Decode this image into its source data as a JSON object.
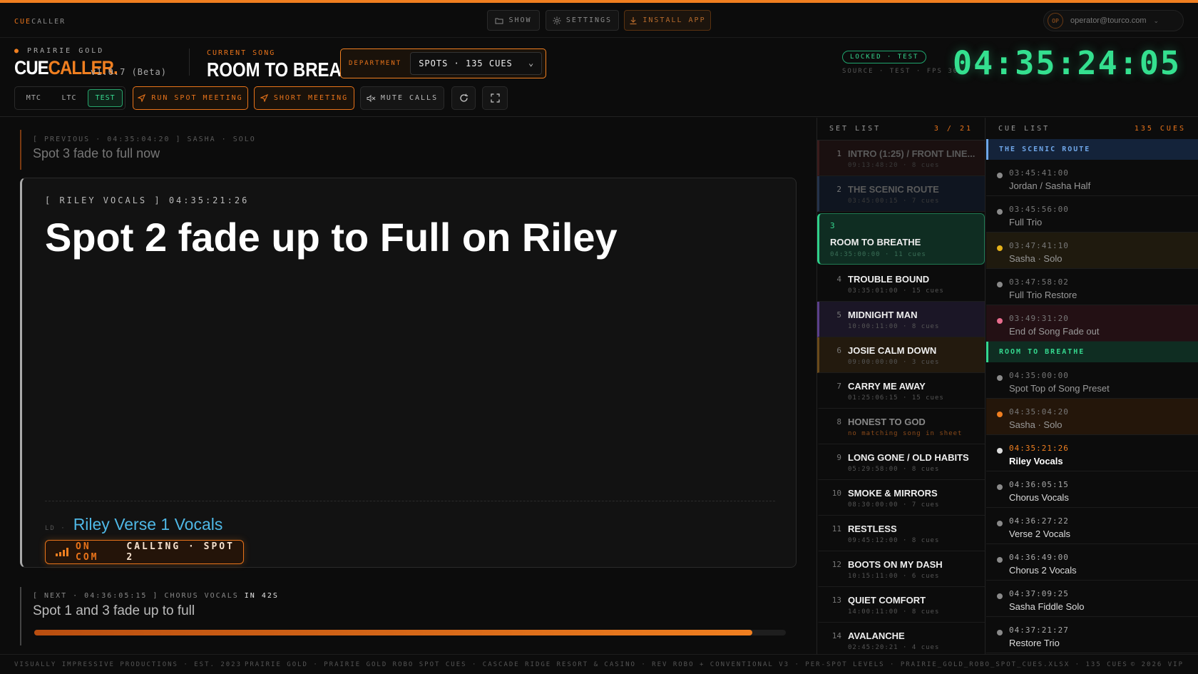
{
  "topbar": {
    "brand_a": "CUE",
    "brand_b": "CALLER",
    "show": "SHOW",
    "settings": "SETTINGS",
    "install": "INSTALL APP",
    "avatar": "OP",
    "email": "operator@tourco.com"
  },
  "header": {
    "band": "PRAIRIE GOLD",
    "logo_a": "CUE",
    "logo_b": "CALLER.",
    "version": "v1.0.7 (Beta)",
    "current_song_label": "CURRENT SONG",
    "current_song": "ROOM TO BREATHE",
    "department_label": "DEPARTMENT",
    "department_value": "SPOTS · 135 CUES",
    "status_badge": "LOCKED · TEST",
    "source": "SOURCE · TEST · FPS 30",
    "timecode": "04:35:24:05",
    "modes": [
      "MTC",
      "LTC",
      "TEST"
    ],
    "active_mode": "TEST",
    "run_spot_meeting": "RUN SPOT MEETING",
    "short_meeting": "SHORT MEETING",
    "mute_calls": "MUTE CALLS"
  },
  "main": {
    "previous_meta": "[ PREVIOUS · 04:35:04:20 ] SASHA · SOLO",
    "previous_text": "Spot 3 fade to full now",
    "current_meta": "[ RILEY VOCALS ]  04:35:21:26",
    "current_cue": "Spot 2 fade up to Full on Riley",
    "ld_label": "LD ·",
    "ld_value": "Riley Verse 1 Vocals",
    "oncom_a": "ON COM",
    "oncom_b": "CALLING · SPOT 2",
    "next_meta": "[ NEXT · 04:36:05:15 ] CHORUS VOCALS",
    "next_in": "IN 42S",
    "next_text": "Spot 1 and 3 fade up to full",
    "next_progress": 0.955
  },
  "setlist": {
    "title": "SET LIST",
    "count": "3 / 21",
    "items": [
      {
        "n": "1",
        "title": "INTRO (1:25) / FRONT LINE...",
        "sub": "09:13:48:20 · 8 cues",
        "state": "past",
        "bg": "#1a1010",
        "accent": "#3a1c1c"
      },
      {
        "n": "2",
        "title": "THE SCENIC ROUTE",
        "sub": "03:45:00:15 · 7 cues",
        "state": "past",
        "bg": "#0f1520",
        "accent": "#24324a"
      },
      {
        "n": "3",
        "title": "ROOM TO BREATHE",
        "sub": "04:35:00:00 · 11 cues",
        "state": "current"
      },
      {
        "n": "4",
        "title": "TROUBLE BOUND",
        "sub": "03:35:01:00 · 15 cues",
        "state": "upcoming"
      },
      {
        "n": "5",
        "title": "MIDNIGHT MAN",
        "sub": "10:00:11:00 · 8 cues",
        "state": "upcoming",
        "bg": "#1b1626",
        "accent": "#5a3f8a"
      },
      {
        "n": "6",
        "title": "JOSIE CALM DOWN",
        "sub": "09:00:00:00 · 3 cues",
        "state": "upcoming",
        "bg": "#231a0e",
        "accent": "#6a4a1a"
      },
      {
        "n": "7",
        "title": "CARRY ME AWAY",
        "sub": "01:25:06:15 · 15 cues",
        "state": "upcoming"
      },
      {
        "n": "8",
        "title": "HONEST TO GOD",
        "sub": "no matching song in sheet",
        "state": "nomatch"
      },
      {
        "n": "9",
        "title": "LONG GONE / OLD HABITS",
        "sub": "05:29:58:00 · 8 cues",
        "state": "upcoming"
      },
      {
        "n": "10",
        "title": "SMOKE & MIRRORS",
        "sub": "08:30:00:00 · 7 cues",
        "state": "upcoming"
      },
      {
        "n": "11",
        "title": "RESTLESS",
        "sub": "09:45:12:00 · 8 cues",
        "state": "upcoming"
      },
      {
        "n": "12",
        "title": "BOOTS ON MY DASH",
        "sub": "10:15:11:00 · 6 cues",
        "state": "upcoming"
      },
      {
        "n": "13",
        "title": "QUIET COMFORT",
        "sub": "14:00:11:00 · 8 cues",
        "state": "upcoming"
      },
      {
        "n": "14",
        "title": "AVALANCHE",
        "sub": "02:45:20:21 · 4 cues",
        "state": "upcoming"
      }
    ]
  },
  "cuelist": {
    "title": "CUE LIST",
    "count": "135 CUES",
    "rows": [
      {
        "kind": "section",
        "label": "THE SCENIC ROUTE",
        "color": "#6fa6e8",
        "bg": "#14233a"
      },
      {
        "kind": "cue",
        "time": "03:45:41:00",
        "name": "Jordan / Sasha Half",
        "dot": "#8a8a8a"
      },
      {
        "kind": "cue",
        "time": "03:45:56:00",
        "name": "Full Trio",
        "dot": "#8a8a8a"
      },
      {
        "kind": "cue",
        "time": "03:47:41:10",
        "name": "Sasha · Solo",
        "dot": "#e6b21a",
        "bg": "#1f1a0e"
      },
      {
        "kind": "cue",
        "time": "03:47:58:02",
        "name": "Full Trio Restore",
        "dot": "#8a8a8a"
      },
      {
        "kind": "cue",
        "time": "03:49:31:20",
        "name": "End of Song Fade out",
        "dot": "#e86d8e",
        "bg": "#231014"
      },
      {
        "kind": "section",
        "label": "ROOM TO BREATHE",
        "color": "#35d88f",
        "bg": "#0f2d22"
      },
      {
        "kind": "cue",
        "time": "04:35:00:00",
        "name": "Spot Top of Song Preset",
        "dot": "#8a8a8a"
      },
      {
        "kind": "cue",
        "time": "04:35:04:20",
        "name": "Sasha · Solo",
        "dot": "#f07f20",
        "bg": "#24160a"
      },
      {
        "kind": "cue",
        "time": "04:35:21:26",
        "name": "Riley Vocals",
        "dot": "#dddddd",
        "state": "active"
      },
      {
        "kind": "cue",
        "time": "04:36:05:15",
        "name": "Chorus Vocals",
        "dot": "#8a8a8a",
        "state": "upcoming"
      },
      {
        "kind": "cue",
        "time": "04:36:27:22",
        "name": "Verse 2 Vocals",
        "dot": "#8a8a8a",
        "state": "upcoming"
      },
      {
        "kind": "cue",
        "time": "04:36:49:00",
        "name": "Chorus 2 Vocals",
        "dot": "#8a8a8a",
        "state": "upcoming"
      },
      {
        "kind": "cue",
        "time": "04:37:09:25",
        "name": "Sasha Fiddle Solo",
        "dot": "#8a8a8a",
        "state": "upcoming"
      },
      {
        "kind": "cue",
        "time": "04:37:21:27",
        "name": "Restore Trio",
        "dot": "#8a8a8a",
        "state": "upcoming"
      }
    ]
  },
  "footer": {
    "left": "VISUALLY IMPRESSIVE PRODUCTIONS · EST. 2023",
    "center": "PRAIRIE GOLD · PRAIRIE GOLD ROBO SPOT CUES · CASCADE RIDGE RESORT & CASINO · REV ROBO + CONVENTIONAL V3 · PER-SPOT LEVELS · PRAIRIE_GOLD_ROBO_SPOT_CUES.XLSX · 135 CUES",
    "right": "© 2026 VIP"
  }
}
